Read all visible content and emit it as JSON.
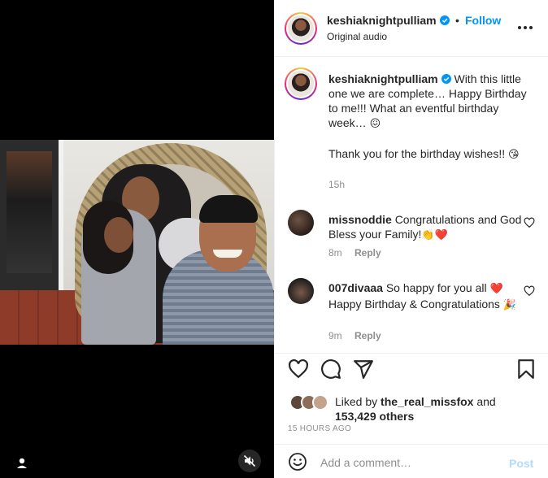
{
  "post": {
    "author": "keshiaknightpulliam",
    "follow_label": "Follow",
    "separator": "•",
    "audio": "Original audio"
  },
  "caption": {
    "author": "keshiaknightpulliam",
    "line1": "With this little one we are complete… Happy Birthday to me!!! What an eventful birthday week…",
    "emoji1": "😖",
    "line2": "Thank you for the birthday wishes!!",
    "emoji2": "😘",
    "time": "15h"
  },
  "comments": [
    {
      "user": "missnoddie",
      "text": "Congratulations and God Bless your Family!",
      "emoji": "👏❤️",
      "time": "8m",
      "reply_label": "Reply"
    },
    {
      "user": "007divaaa",
      "text": "So happy for you all",
      "emoji_mid": "❤️",
      "text2": "Happy Birthday & Congratulations",
      "emoji_end": "🎉",
      "time": "9m",
      "reply_label": "Reply"
    }
  ],
  "likes": {
    "prefix": "Liked by",
    "user": "the_real_missfox",
    "conj": "and",
    "others": "153,429 others",
    "time_ago": "15 HOURS AGO"
  },
  "composer": {
    "placeholder": "Add a comment…",
    "post_label": "Post"
  },
  "icons": [
    "user-tag-icon",
    "mute-icon",
    "verified-icon",
    "more-icon",
    "heart-icon",
    "comment-icon",
    "share-icon",
    "bookmark-icon",
    "emoji-icon"
  ],
  "colors": {
    "accent": "#0095f6",
    "post_disabled": "#b3dbff",
    "muted": "#8e8e8e",
    "heart_red": "#ed4956"
  }
}
